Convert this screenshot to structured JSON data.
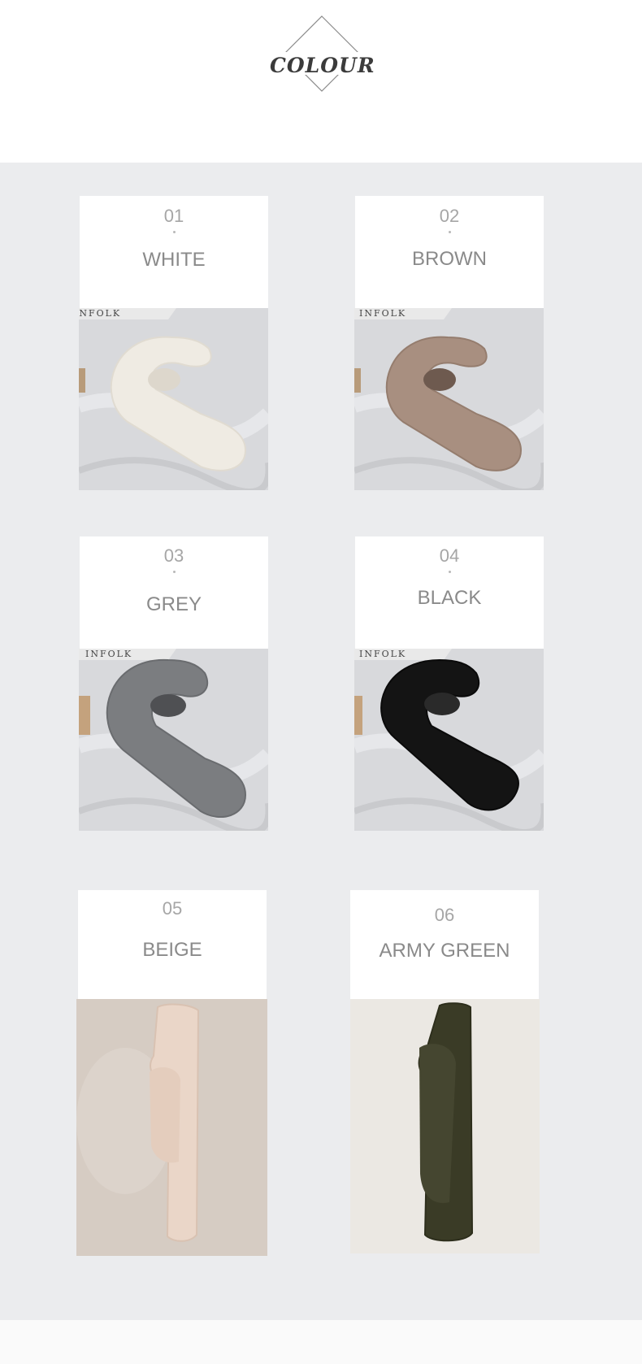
{
  "header": {
    "title": "COLOUR"
  },
  "colors": {
    "panel_background": "#ebecee",
    "card_background": "#ffffff",
    "number_text": "#a6a6a6",
    "label_text": "#8a8a8a"
  },
  "photo_brand_text": "INFOLK",
  "swatches": [
    {
      "number": "01",
      "name": "WHITE",
      "scarf_color": "#eeeae2"
    },
    {
      "number": "02",
      "name": "BROWN",
      "scarf_color": "#a88f80"
    },
    {
      "number": "03",
      "name": "GREY",
      "scarf_color": "#7b7d80"
    },
    {
      "number": "04",
      "name": "BLACK",
      "scarf_color": "#141414"
    },
    {
      "number": "05",
      "name": "BEIGE",
      "scarf_color": "#ead6c8"
    },
    {
      "number": "06",
      "name": "ARMY GREEN",
      "scarf_color": "#3a3b26"
    }
  ]
}
